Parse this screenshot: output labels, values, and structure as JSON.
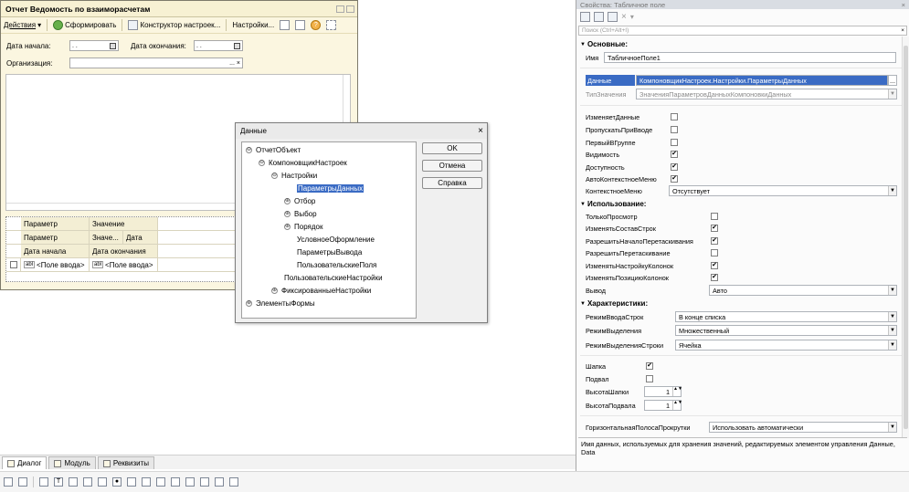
{
  "report_window": {
    "title": "Отчет  Ведомость по взаиморасчетам",
    "toolbar": {
      "actions": "Действия",
      "form": "Сформировать",
      "constructor": "Конструктор настроек...",
      "settings": "Настройки..."
    },
    "date_start_label": "Дата начала:",
    "date_start_value": ". .",
    "date_end_label": "Дата окончания:",
    "date_end_value": ". .",
    "org_label": "Организация:",
    "table": {
      "header_row1": [
        "Параметр",
        "Значение"
      ],
      "header_row2": [
        "Параметр",
        "Значе...",
        "Дата"
      ],
      "header_row3": [
        "Дата начала",
        "Дата окончания"
      ],
      "data_row": [
        "<Поле ввода>",
        "<Поле ввода>"
      ],
      "abl": "abl"
    }
  },
  "data_dialog": {
    "title": "Данные",
    "tree": [
      {
        "text": "ОтчетОбъект",
        "exp": "⊖"
      },
      {
        "text": "КомпоновщикНастроек",
        "exp": "⊖"
      },
      {
        "text": "Настройки",
        "exp": "⊖"
      },
      {
        "text": "ПараметрыДанных",
        "exp": ""
      },
      {
        "text": "Отбор",
        "exp": "⊕"
      },
      {
        "text": "Выбор",
        "exp": "⊕"
      },
      {
        "text": "Порядок",
        "exp": "⊕"
      },
      {
        "text": "УсловноеОформление",
        "exp": ""
      },
      {
        "text": "ПараметрыВывода",
        "exp": ""
      },
      {
        "text": "ПользовательскиеПоля",
        "exp": ""
      },
      {
        "text": "ПользовательскиеНастройки",
        "exp": ""
      },
      {
        "text": "ФиксированныеНастройки",
        "exp": "⊕"
      },
      {
        "text": "ЭлементыФормы",
        "exp": "⊕"
      }
    ],
    "ok": "OK",
    "cancel": "Отмена",
    "help": "Справка"
  },
  "properties": {
    "title": "Свойства: Табличное поле",
    "search_placeholder": "Поиск (Ctrl+Alt+I)",
    "group_main": "Основные:",
    "name_label": "Имя",
    "name_value": "ТабличноеПоле1",
    "data_label": "Данные",
    "data_value": "КомпоновщикНастроек.Настройки.ПараметрыДанных",
    "type_label": "ТипЗначения",
    "type_value": "ЗначенияПараметровДанныхКомпоновкиДанных",
    "changes_data": "ИзменяетДанные",
    "skip_on_input": "ПропускатьПриВводе",
    "first_in_group": "ПервыйВГруппе",
    "visibility": "Видимость",
    "availability": "Доступность",
    "auto_context_menu": "АвтоКонтекстноеМеню",
    "context_menu_label": "КонтекстноеМеню",
    "context_menu_value": "Отсутствует",
    "group_usage": "Использование:",
    "read_only": "ТолькоПросмотр",
    "change_rows": "ИзменятьСоставСтрок",
    "allow_drag_start": "РазрешитьНачалоПеретаскивания",
    "allow_drag": "РазрешитьПеретаскивание",
    "change_column_settings": "ИзменятьНастройкуКолонок",
    "change_column_position": "ИзменятьПозициюКолонок",
    "output_label": "Вывод",
    "output_value": "Авто",
    "group_characteristics": "Характеристики:",
    "input_mode_label": "РежимВводаСтрок",
    "input_mode_value": "В конце списка",
    "selection_mode_label": "РежимВыделения",
    "selection_mode_value": "Множественный",
    "row_selection_mode_label": "РежимВыделенияСтроки",
    "row_selection_mode_value": "Ячейка",
    "header": "Шапка",
    "footer": "Подвал",
    "header_height_label": "ВысотаШапки",
    "header_height_value": "1",
    "footer_height_label": "ВысотаПодвала",
    "footer_height_value": "1",
    "hscroll_label": "ГоризонтальнаяПолосаПрокрутки",
    "hscroll_value": "Использовать автоматически",
    "description": "Имя данных, используемых для хранения значений, редактируемых элементом управления Данные, Data"
  },
  "tabs": [
    "Диалог",
    "Модуль",
    "Реквизиты"
  ],
  "check_mark": "✔",
  "spin_arrows": "▲▼",
  "dropdown_arrow": "▼",
  "ellipsis": "...",
  "close_x": "×"
}
